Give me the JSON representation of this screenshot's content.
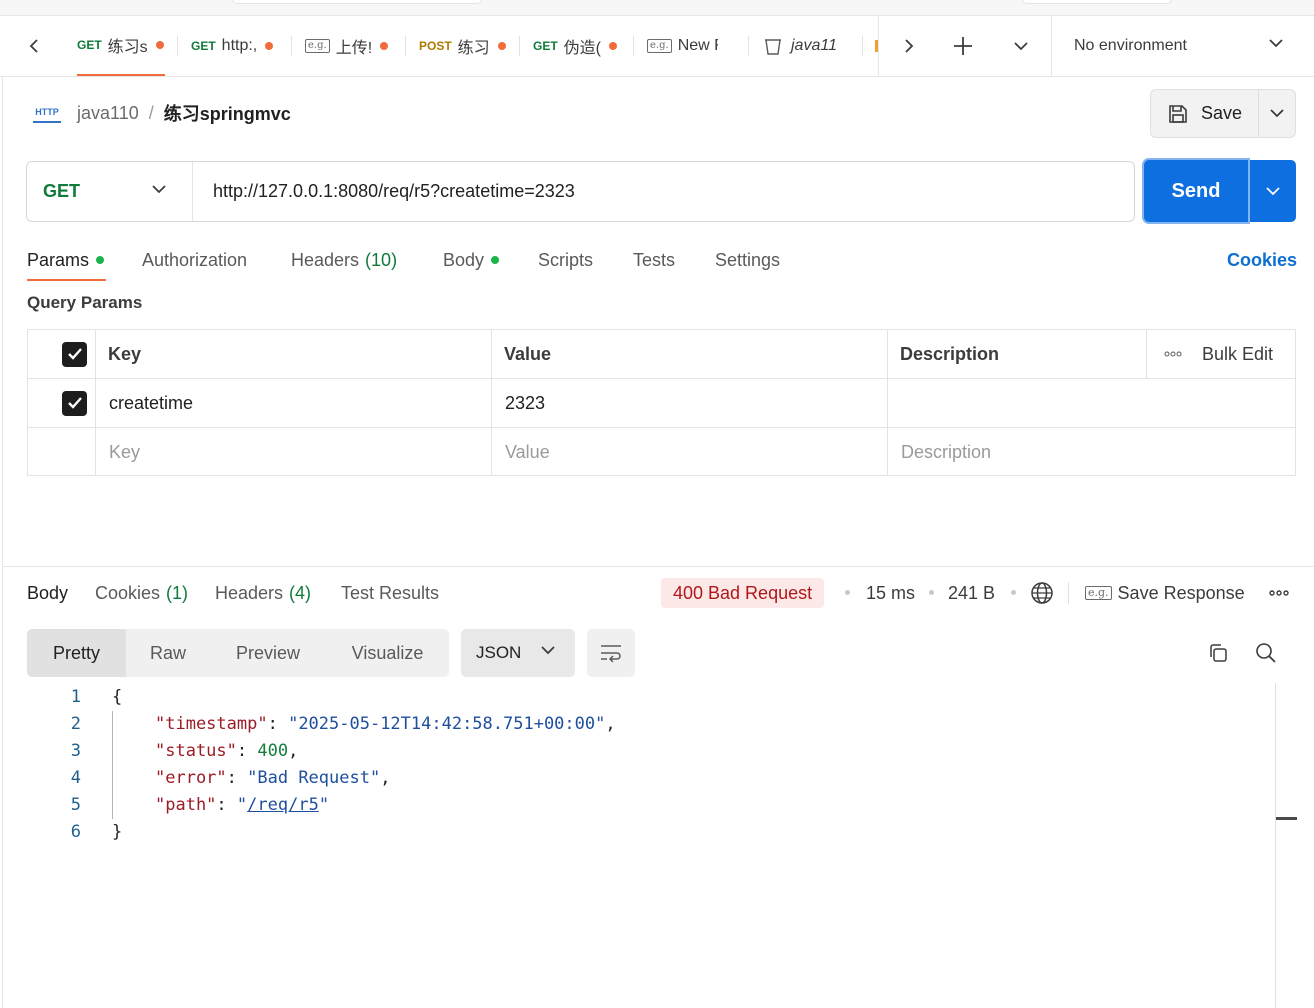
{
  "tabs": [
    {
      "method": "GET",
      "name": "练习s",
      "dot": true,
      "active": true
    },
    {
      "method": "GET",
      "name": "http:,",
      "dot": true
    },
    {
      "method": "",
      "name": "上传!",
      "dot": true,
      "eg": true
    },
    {
      "method": "POST",
      "name": "练习",
      "dot": true
    },
    {
      "method": "GET",
      "name": "伪造(",
      "dot": true
    },
    {
      "method": "",
      "name": "New F",
      "dot": false,
      "eg": true
    },
    {
      "method": "",
      "name": "java11",
      "dot": false,
      "collection": true
    }
  ],
  "eg_label": "e.g.",
  "environment": "No environment",
  "breadcrumb": {
    "collection": "java110",
    "separator": "/",
    "request": "练习springmvc",
    "http_label": "HTTP"
  },
  "save": {
    "label": "Save"
  },
  "request": {
    "method": "GET",
    "url": "http://127.0.0.1:8080/req/r5?createtime=2323",
    "send_label": "Send"
  },
  "request_tabs": {
    "params": "Params",
    "authorization": "Authorization",
    "headers": "Headers",
    "headers_count": "(10)",
    "body": "Body",
    "scripts": "Scripts",
    "tests": "Tests",
    "settings": "Settings",
    "cookies": "Cookies"
  },
  "query_params": {
    "title": "Query Params",
    "headers": {
      "key": "Key",
      "value": "Value",
      "description": "Description",
      "bulk_edit": "Bulk Edit"
    },
    "rows": [
      {
        "key": "createtime",
        "value": "2323",
        "description": "",
        "checked": true
      }
    ],
    "placeholder": {
      "key": "Key",
      "value": "Value",
      "description": "Description"
    }
  },
  "response": {
    "tabs": {
      "body": "Body",
      "cookies": "Cookies",
      "cookies_count": "(1)",
      "headers": "Headers",
      "headers_count": "(4)",
      "test_results": "Test Results"
    },
    "status": "400 Bad Request",
    "time": "15 ms",
    "size": "241 B",
    "save_response": "Save Response",
    "views": [
      "Pretty",
      "Raw",
      "Preview",
      "Visualize"
    ],
    "format": "JSON",
    "code_lines": [
      {
        "n": "1",
        "text": "{"
      },
      {
        "n": "2",
        "key": "\"timestamp\"",
        "value": "\"2025-05-12T14:42:58.751+00:00\"",
        "type": "string",
        "comma": ","
      },
      {
        "n": "3",
        "key": "\"status\"",
        "value": "400",
        "type": "number",
        "comma": ","
      },
      {
        "n": "4",
        "key": "\"error\"",
        "value": "\"Bad Request\"",
        "type": "string",
        "comma": ","
      },
      {
        "n": "5",
        "key": "\"path\"",
        "value_link": "/req/r5",
        "type": "link",
        "comma": ""
      },
      {
        "n": "6",
        "text": "}"
      }
    ]
  },
  "colors": {
    "accent": "#f26b3a",
    "send": "#0d6fe0",
    "get": "#0f7b3a",
    "post": "#ad7a03",
    "status_error_bg": "#fde8e8",
    "status_error_text": "#b0171b"
  }
}
